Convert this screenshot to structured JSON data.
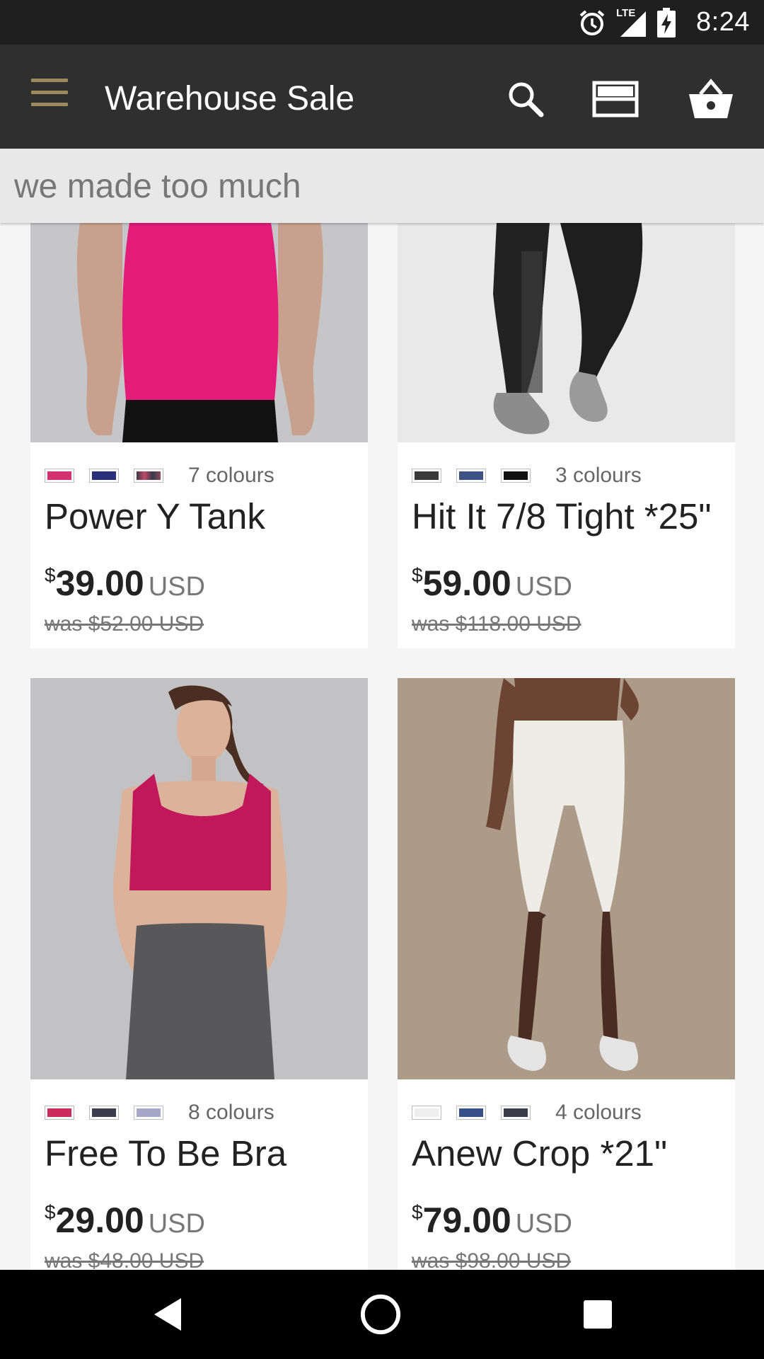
{
  "status_bar": {
    "time": "8:24",
    "network": "LTE"
  },
  "toolbar": {
    "title": "Warehouse Sale",
    "icons": [
      "menu-icon",
      "search-icon",
      "view-toggle-icon",
      "basket-icon"
    ]
  },
  "subheader": {
    "text": "we made too much"
  },
  "products": [
    {
      "name": "Power Y Tank",
      "colours": "7 colours",
      "currency_symbol": "$",
      "price": "39.00",
      "unit": "USD",
      "was": "was $52.00 USD",
      "swatches": [
        "#d2336f",
        "#2a2f7a",
        "#3a3a4a"
      ]
    },
    {
      "name": "Hit It 7/8 Tight *25\"",
      "colours": "3 colours",
      "currency_symbol": "$",
      "price": "59.00",
      "unit": "USD",
      "was": "was $118.00 USD",
      "swatches": [
        "#3a3a3a",
        "#3f5283",
        "#111111"
      ]
    },
    {
      "name": "Free To Be Bra",
      "colours": "8 colours",
      "currency_symbol": "$",
      "price": "29.00",
      "unit": "USD",
      "was": "was $48.00 USD",
      "swatches": [
        "#cc2a5d",
        "#3c3c4e",
        "#a7a8c8"
      ]
    },
    {
      "name": "Anew Crop *21\"",
      "colours": "4 colours",
      "currency_symbol": "$",
      "price": "79.00",
      "unit": "USD",
      "was": "was $98.00 USD",
      "swatches": [
        "#eeeeee",
        "#36508a",
        "#3a3c4a"
      ]
    }
  ],
  "nav": {
    "icons": [
      "back-icon",
      "home-icon",
      "recents-icon"
    ]
  }
}
